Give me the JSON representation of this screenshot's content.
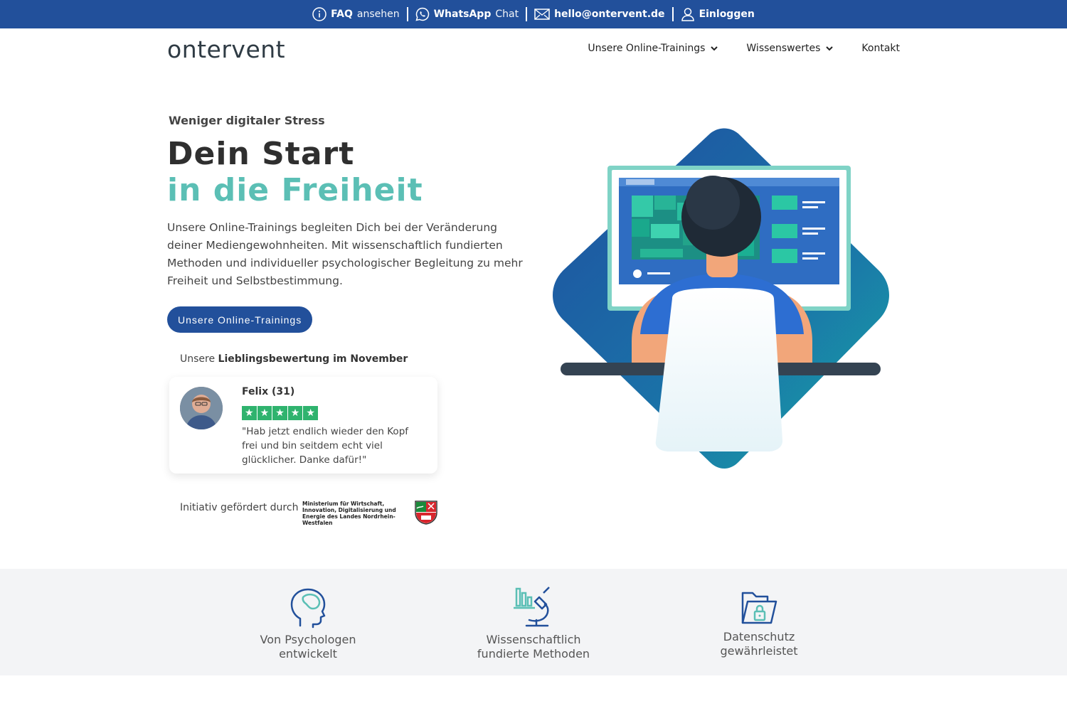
{
  "topbar": {
    "faq_bold": "FAQ",
    "faq_rest": "ansehen",
    "whatsapp_bold": "WhatsApp",
    "whatsapp_rest": "Chat",
    "email": "hello@ontervent.de",
    "login": "Einloggen"
  },
  "header": {
    "logo": "ontervent",
    "nav": [
      {
        "label": "Unsere Online-Trainings"
      },
      {
        "label": "Wissenswertes"
      },
      {
        "label": "Kontakt"
      }
    ]
  },
  "hero": {
    "eyebrow": "Weniger digitaler Stress",
    "title_line1": "Dein Start",
    "title_line2": "in die Freiheit",
    "lead": "Unsere Online-Trainings begleiten Dich bei der Veränderung deiner Mediengewohnheiten. Mit wissenschaftlich fundierten Methoden und individueller psychologischer Begleitung zu mehr Freiheit und Selbstbestimmung.",
    "cta": "Unsere Online-Trainings"
  },
  "review": {
    "label_prefix": "Unsere",
    "label_bold": "Lieblingsbewertung im November",
    "name": "Felix (31)",
    "rating": 5,
    "text": "\"Hab jetzt endlich wieder den Kopf frei und bin seitdem echt viel glücklicher. Danke dafür!\""
  },
  "funding": {
    "label": "Initiativ gefördert durch",
    "ministry": "Ministerium für Wirtschaft, Innovation, Digitalisierung und Energie des Landes Nordrhein-Westfalen"
  },
  "features": [
    {
      "icon": "head-icon",
      "line1": "Von Psychologen",
      "line2": "entwickelt"
    },
    {
      "icon": "microscope-icon",
      "line1": "Wissenschaftlich",
      "line2": "fundierte Methoden"
    },
    {
      "icon": "folder-lock-icon",
      "line1": "Datenschutz",
      "line2": "gewährleistet"
    }
  ],
  "colors": {
    "primary": "#22509b",
    "accent": "#5bbfb5",
    "stars": "#2fb36e"
  }
}
